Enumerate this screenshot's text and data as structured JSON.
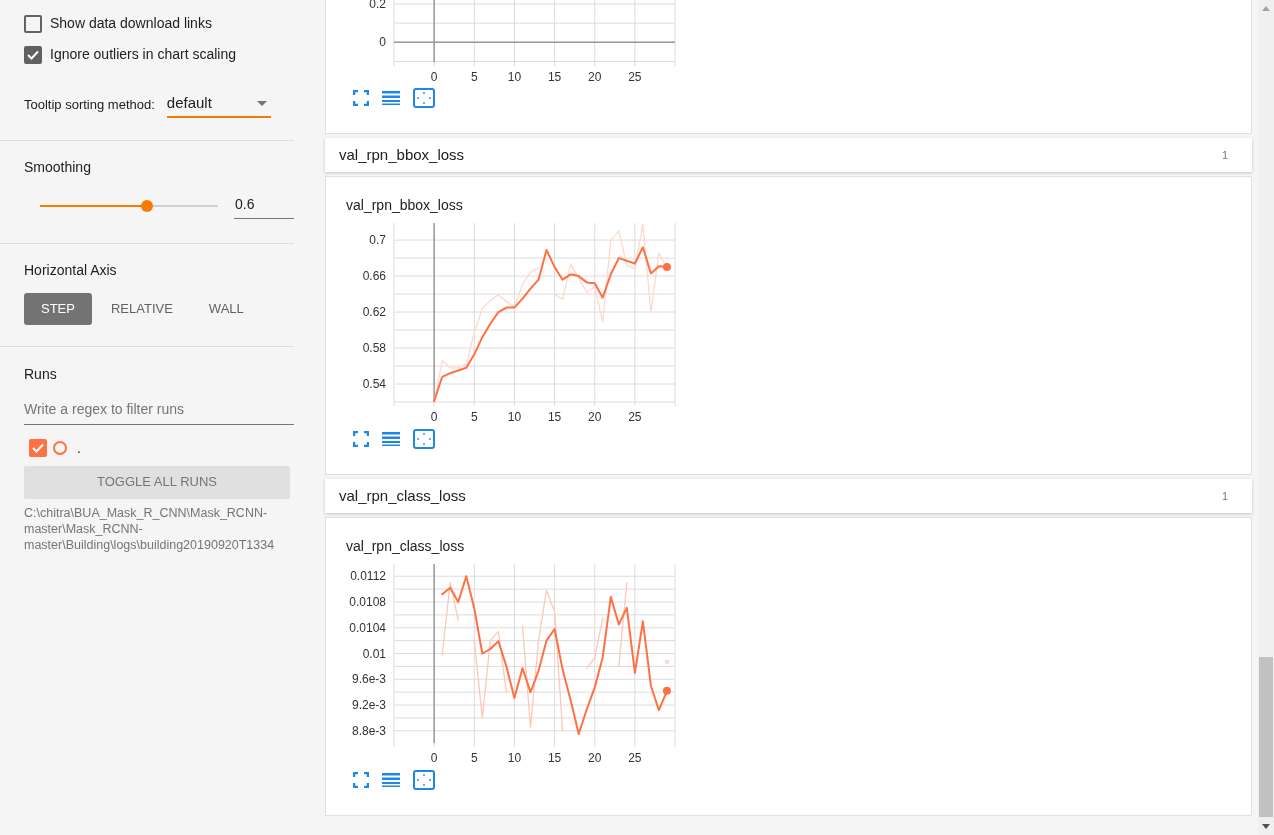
{
  "settings": {
    "checkboxes": [
      {
        "label": "Show data download links",
        "checked": false
      },
      {
        "label": "Ignore outliers in chart scaling",
        "checked": true
      }
    ],
    "tooltip_sorting": {
      "label": "Tooltip sorting method:",
      "value": "default"
    },
    "smoothing": {
      "label": "Smoothing",
      "level": 0.6,
      "value": "0.6"
    },
    "horizontal_axis": {
      "label": "Horizontal Axis",
      "options": [
        {
          "label": "STEP",
          "selected": true
        },
        {
          "label": "RELATIVE",
          "selected": false
        },
        {
          "label": "WALL",
          "selected": false
        }
      ]
    },
    "runs": {
      "label": "Runs",
      "placeholder": "Write a regex to filter runs",
      "items": [
        {
          "label": ".",
          "checked": true,
          "color": "#ff7043"
        }
      ],
      "toggle_button": "TOGGLE ALL RUNS",
      "path": "C:\\chitra\\BUA_Mask_R_CNN\\Mask_RCNN-master\\Mask_RCNN-master\\Building\\logs\\building20190920T1334"
    }
  },
  "cards": [
    {
      "kind": "chart",
      "chart_data": {
        "type": "line",
        "grid": true,
        "xlim": [
          -5,
          30
        ],
        "ylim": [
          -0.103,
          0.273
        ],
        "xticks": [
          0,
          5,
          10,
          15,
          20,
          25
        ],
        "yticks": [
          0,
          0.2
        ]
      }
    },
    {
      "kind": "group",
      "title": "val_rpn_bbox_loss",
      "count": "1"
    },
    {
      "kind": "chart",
      "title": "val_rpn_bbox_loss",
      "chart_data": {
        "type": "line",
        "grid": true,
        "xlim": [
          -5,
          30
        ],
        "ylim": [
          0.52,
          0.719
        ],
        "xticks": [
          0,
          5,
          10,
          15,
          20,
          25
        ],
        "yticks": [
          0.54,
          0.58,
          0.62,
          0.66,
          0.7
        ],
        "x": [
          0,
          1,
          2,
          3,
          4,
          5,
          6,
          7,
          8,
          9,
          10,
          11,
          12,
          13,
          14,
          15,
          16,
          17,
          18,
          19,
          20,
          21,
          22,
          23,
          24,
          25,
          26,
          27,
          28,
          29
        ],
        "series": [
          {
            "color": "#ff7043",
            "values": [
              0.521,
              0.548,
              0.552,
              0.555,
              0.558,
              0.573,
              0.592,
              0.607,
              0.62,
              0.625,
              0.625,
              0.635,
              0.646,
              0.656,
              0.689,
              0.67,
              0.656,
              0.662,
              0.66,
              0.653,
              0.652,
              0.636,
              0.662,
              0.68,
              0.677,
              0.674,
              0.692,
              0.663,
              0.671,
              0.67
            ]
          },
          {
            "color": "#fdd9cd",
            "values": [
              0.52,
              0.566,
              0.558,
              0.558,
              0.562,
              0.597,
              0.624,
              0.633,
              0.639,
              0.632,
              0.625,
              0.651,
              0.664,
              0.669,
              null,
              0.64,
              0.634,
              0.673,
              0.658,
              0.642,
              0.648,
              0.609,
              0.7,
              0.71,
              0.672,
              0.668,
              0.718,
              0.62,
              0.686,
              0.668
            ]
          }
        ]
      }
    },
    {
      "kind": "group",
      "title": "val_rpn_class_loss",
      "count": "1"
    },
    {
      "kind": "chart",
      "title": "val_rpn_class_loss",
      "chart_data": {
        "type": "line",
        "grid": true,
        "xlim": [
          -5,
          30
        ],
        "ylim": [
          0.00861,
          0.01139
        ],
        "xticks": [
          0,
          5,
          10,
          15,
          20,
          25
        ],
        "yticks": [
          {
            "value": 0.0088,
            "label": "8.8e-3"
          },
          {
            "value": 0.0092,
            "label": "9.2e-3"
          },
          {
            "value": 0.0096,
            "label": "9.6e-3"
          },
          {
            "value": 0.01,
            "label": "0.01"
          },
          {
            "value": 0.0104,
            "label": "0.0104"
          },
          {
            "value": 0.0108,
            "label": "0.0108"
          },
          {
            "value": 0.0112,
            "label": "0.0112"
          }
        ],
        "x": [
          1,
          2,
          3,
          4,
          5,
          6,
          7,
          8,
          9,
          10,
          11,
          12,
          13,
          14,
          15,
          16,
          17,
          18,
          19,
          20,
          21,
          22,
          23,
          24,
          25,
          26,
          27,
          28,
          29
        ],
        "series": [
          {
            "color": "#ff7043",
            "values": [
              0.01092,
              0.01102,
              0.0108,
              0.0112,
              0.0107,
              0.01,
              0.01007,
              0.01019,
              0.0098,
              0.00931,
              0.00977,
              0.0094,
              0.00973,
              0.0102,
              0.01038,
              0.00975,
              0.00928,
              0.00875,
              0.00913,
              0.00947,
              0.00994,
              0.01088,
              0.01045,
              0.01071,
              0.0097,
              0.0105,
              0.0095,
              0.00912,
              0.00942
            ]
          },
          {
            "color": "#fcc8b8",
            "values": [
              0.00998,
              0.0111,
              0.01052,
              null,
              0.0102,
              0.009,
              0.0102,
              0.01034,
              0.0094,
              null,
              0.01043,
              0.00885,
              0.0102,
              0.01098,
              0.01065,
              0.0088,
              null,
              null,
              0.00977,
              0.00993,
              0.01055,
              null,
              0.0098,
              0.0111,
              null,
              null,
              null,
              null,
              0.00987
            ]
          }
        ]
      }
    }
  ]
}
